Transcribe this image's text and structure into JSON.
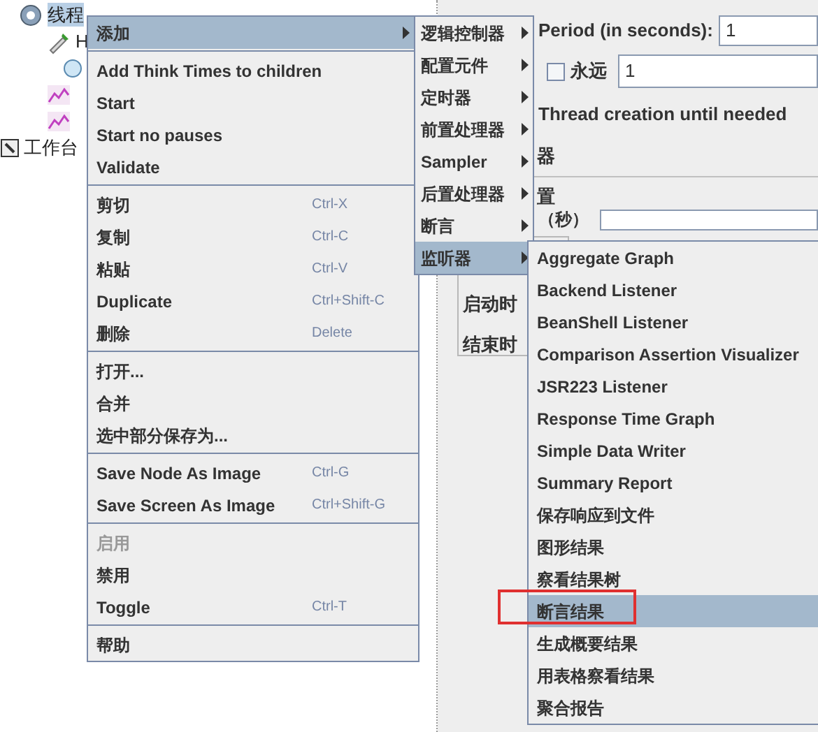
{
  "tree": [
    {
      "label": "线程",
      "kind": "thread-group",
      "selected": true,
      "children": [
        {
          "label": "H",
          "kind": "sampler",
          "children": [
            {
              "kind": "config"
            }
          ]
        },
        {
          "kind": "listener"
        },
        {
          "kind": "listener"
        }
      ]
    },
    {
      "label": "工作台",
      "kind": "workbench",
      "selected": false
    }
  ],
  "form": {
    "period_label": "Period (in seconds):",
    "period_value": "1",
    "forever": {
      "label": "永远",
      "checked": false
    },
    "loop_value": "1",
    "thread_creation": "Thread creation until needed",
    "section_label_1": "器",
    "section_label_2": "置",
    "duration_label": "（秒）",
    "start_label": "启动时",
    "end_label": "结束时"
  },
  "context_menu": {
    "items": [
      {
        "kind": "item",
        "label": "添加",
        "submenu": true,
        "selected": true,
        "disabled": false
      },
      {
        "kind": "separator"
      },
      {
        "kind": "item",
        "label": "Add Think Times to children",
        "submenu": false,
        "selected": false,
        "disabled": false
      },
      {
        "kind": "item",
        "label": "Start",
        "submenu": false,
        "selected": false,
        "disabled": false
      },
      {
        "kind": "item",
        "label": "Start no pauses",
        "submenu": false,
        "selected": false,
        "disabled": false
      },
      {
        "kind": "item",
        "label": "Validate",
        "submenu": false,
        "selected": false,
        "disabled": false
      },
      {
        "kind": "separator"
      },
      {
        "kind": "item",
        "label": "剪切",
        "shortcut": "Ctrl-X",
        "submenu": false,
        "selected": false,
        "disabled": false
      },
      {
        "kind": "item",
        "label": "复制",
        "shortcut": "Ctrl-C",
        "submenu": false,
        "selected": false,
        "disabled": false
      },
      {
        "kind": "item",
        "label": "粘贴",
        "shortcut": "Ctrl-V",
        "submenu": false,
        "selected": false,
        "disabled": false
      },
      {
        "kind": "item",
        "label": "Duplicate",
        "shortcut": "Ctrl+Shift-C",
        "submenu": false,
        "selected": false,
        "disabled": false
      },
      {
        "kind": "item",
        "label": "删除",
        "shortcut": "Delete",
        "submenu": false,
        "selected": false,
        "disabled": false
      },
      {
        "kind": "separator"
      },
      {
        "kind": "item",
        "label": "打开...",
        "submenu": false,
        "selected": false,
        "disabled": false
      },
      {
        "kind": "item",
        "label": "合并",
        "submenu": false,
        "selected": false,
        "disabled": false
      },
      {
        "kind": "item",
        "label": "选中部分保存为...",
        "submenu": false,
        "selected": false,
        "disabled": false
      },
      {
        "kind": "separator"
      },
      {
        "kind": "item",
        "label": "Save Node As Image",
        "shortcut": "Ctrl-G",
        "submenu": false,
        "selected": false,
        "disabled": false
      },
      {
        "kind": "item",
        "label": "Save Screen As Image",
        "shortcut": "Ctrl+Shift-G",
        "submenu": false,
        "selected": false,
        "disabled": false
      },
      {
        "kind": "separator"
      },
      {
        "kind": "item",
        "label": "启用",
        "submenu": false,
        "selected": false,
        "disabled": true
      },
      {
        "kind": "item",
        "label": "禁用",
        "submenu": false,
        "selected": false,
        "disabled": false
      },
      {
        "kind": "item",
        "label": "Toggle",
        "shortcut": "Ctrl-T",
        "submenu": false,
        "selected": false,
        "disabled": false
      },
      {
        "kind": "separator"
      },
      {
        "kind": "item",
        "label": "帮助",
        "submenu": false,
        "selected": false,
        "disabled": false
      }
    ]
  },
  "add_submenu": {
    "items": [
      {
        "label": "逻辑控制器",
        "selected": false
      },
      {
        "label": "配置元件",
        "selected": false
      },
      {
        "label": "定时器",
        "selected": false
      },
      {
        "label": "前置处理器",
        "selected": false
      },
      {
        "label": "Sampler",
        "selected": false
      },
      {
        "label": "后置处理器",
        "selected": false
      },
      {
        "label": "断言",
        "selected": false
      },
      {
        "label": "监听器",
        "selected": true
      }
    ]
  },
  "listener_submenu": {
    "items": [
      {
        "label": "Aggregate Graph",
        "selected": false
      },
      {
        "label": "Backend Listener",
        "selected": false
      },
      {
        "label": "BeanShell Listener",
        "selected": false
      },
      {
        "label": "Comparison Assertion Visualizer",
        "selected": false
      },
      {
        "label": "JSR223 Listener",
        "selected": false
      },
      {
        "label": "Response Time Graph",
        "selected": false
      },
      {
        "label": "Simple Data Writer",
        "selected": false
      },
      {
        "label": "Summary Report",
        "selected": false
      },
      {
        "label": "保存响应到文件",
        "selected": false
      },
      {
        "label": "图形结果",
        "selected": false
      },
      {
        "label": "察看结果树",
        "selected": false
      },
      {
        "label": "断言结果",
        "selected": true
      },
      {
        "label": "生成概要结果",
        "selected": false
      },
      {
        "label": "用表格察看结果",
        "selected": false
      },
      {
        "label": "聚合报告",
        "selected": false
      }
    ]
  }
}
